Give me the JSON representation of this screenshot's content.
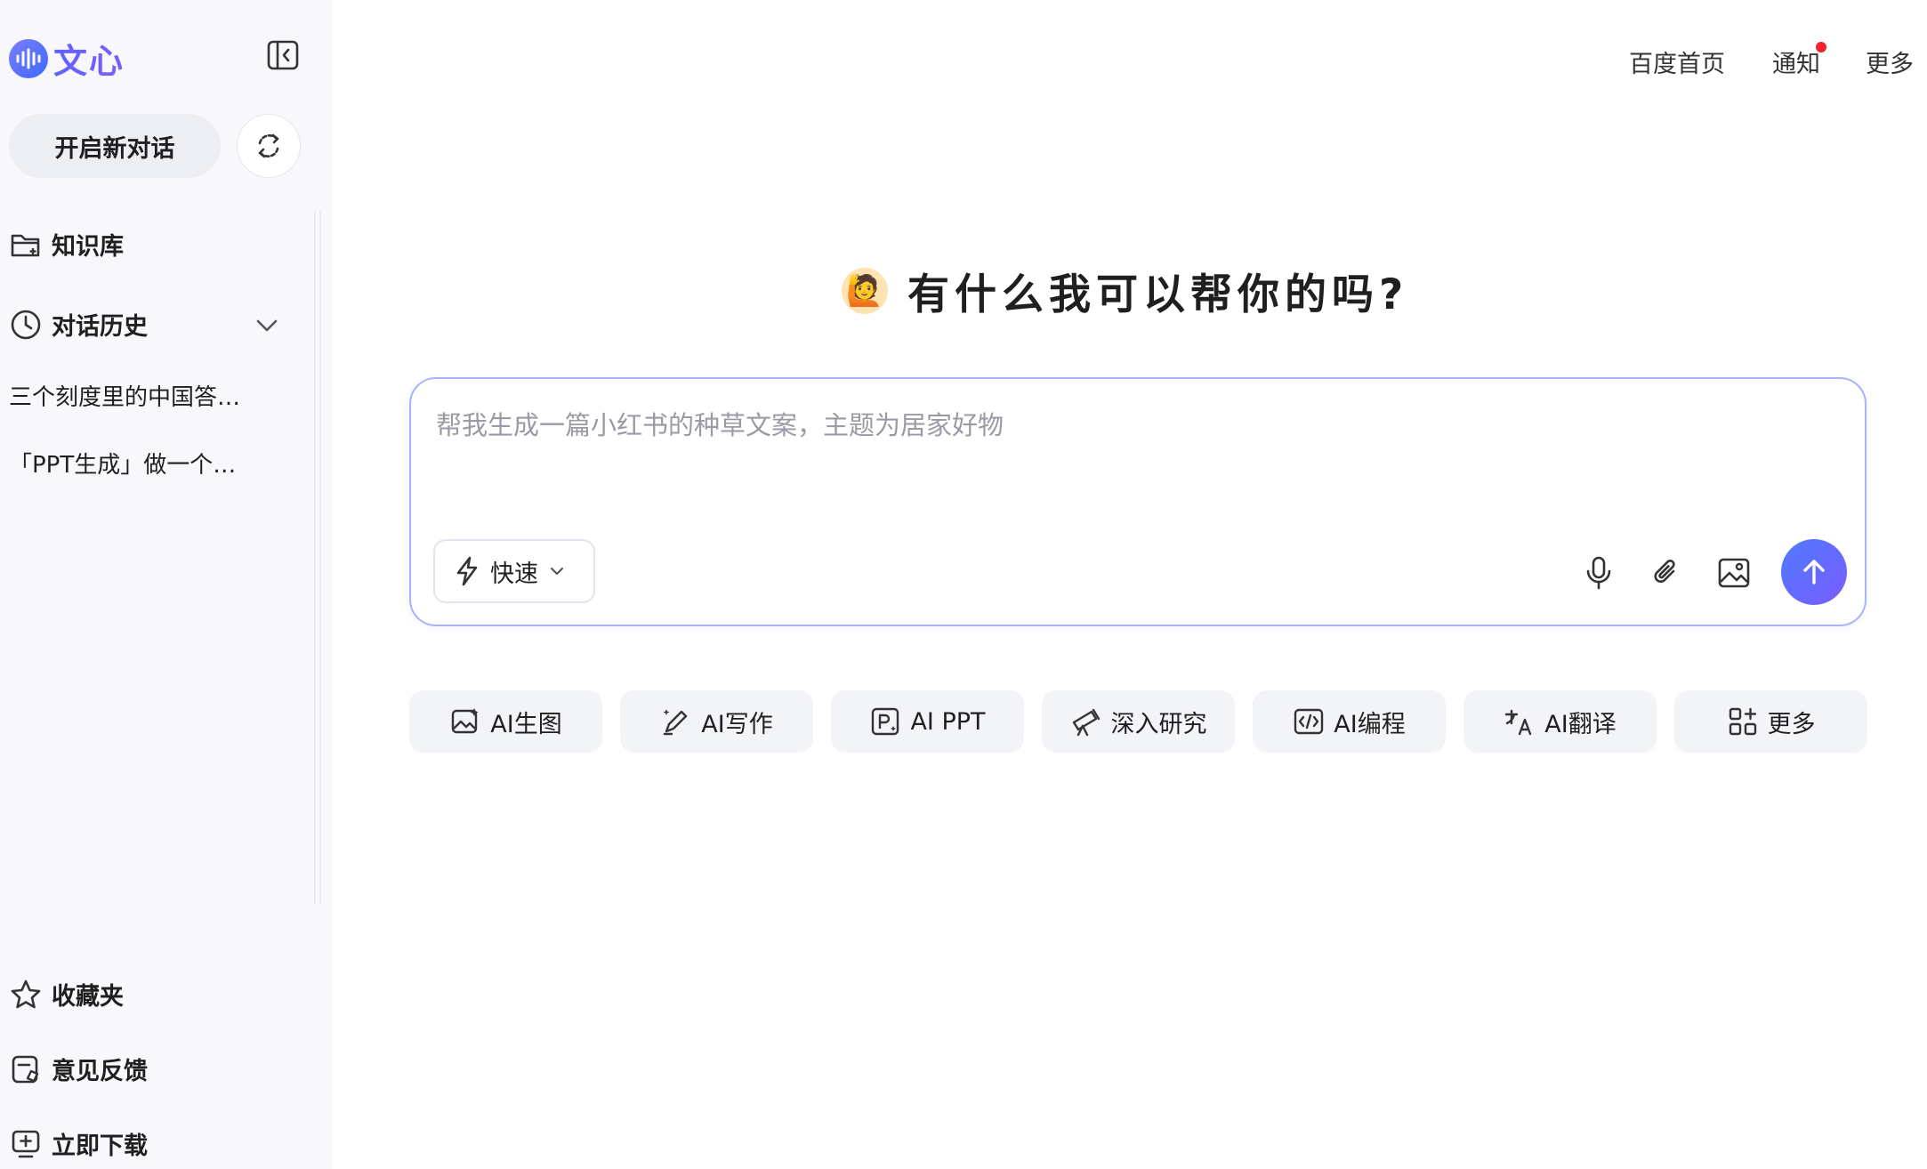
{
  "sidebar": {
    "logo_text": "文心",
    "new_chat_label": "开启新对话",
    "knowledge_label": "知识库",
    "history_label": "对话历史",
    "history_items": [
      "三个刻度里的中国答…",
      "「PPT生成」做一个…"
    ],
    "favorites_label": "收藏夹",
    "feedback_label": "意见反馈",
    "download_label": "立即下载"
  },
  "topnav": {
    "home_label": "百度首页",
    "notify_label": "通知",
    "more_label": "更多"
  },
  "main": {
    "greeting": "有什么我可以帮你的吗?",
    "greeting_emoji": "🙋",
    "input_placeholder": "帮我生成一篇小红书的种草文案，主题为居家好物",
    "mode_label": "快速",
    "chips": [
      {
        "label": "AI生图",
        "icon": "image-gen-icon"
      },
      {
        "label": "AI写作",
        "icon": "pen-icon"
      },
      {
        "label": "AI PPT",
        "icon": "ppt-icon"
      },
      {
        "label": "深入研究",
        "icon": "telescope-icon"
      },
      {
        "label": "AI编程",
        "icon": "code-icon"
      },
      {
        "label": "AI翻译",
        "icon": "translate-icon"
      },
      {
        "label": "更多",
        "icon": "apps-icon"
      }
    ]
  },
  "colors": {
    "accent": "#5e63ff",
    "send_gradient_start": "#4f7bff",
    "send_gradient_end": "#7a5cff",
    "notify_dot": "#f5222d",
    "input_border": "#a9b3ff"
  }
}
